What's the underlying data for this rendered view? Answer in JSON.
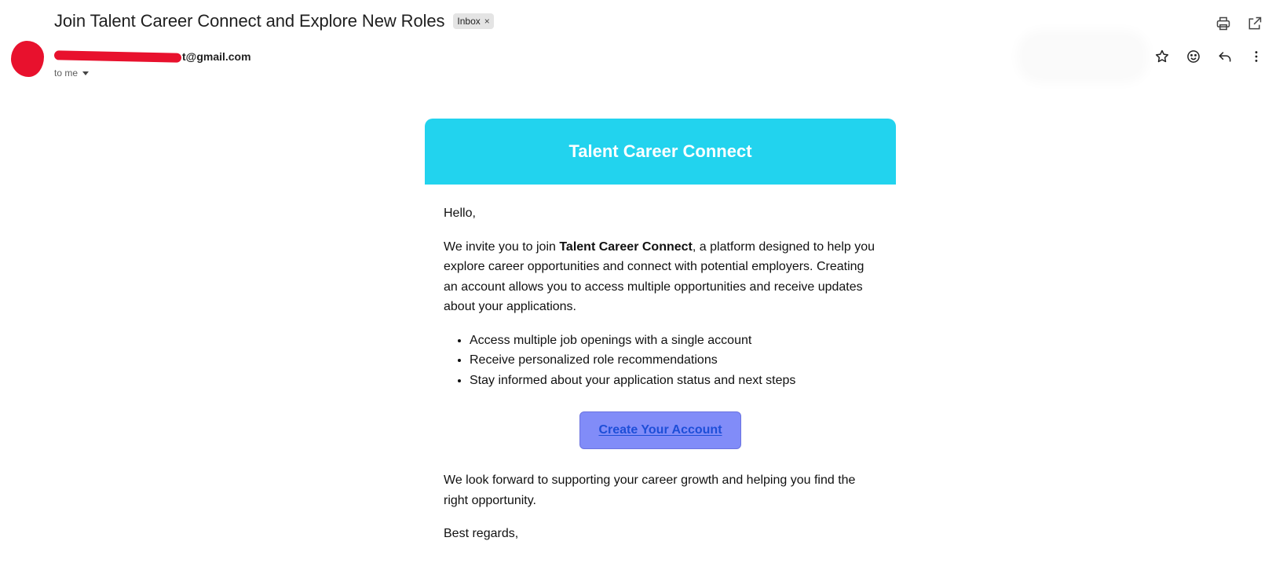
{
  "subject": "Join Talent Career Connect and Explore New Roles",
  "label": {
    "text": "Inbox",
    "remove": "×"
  },
  "sender": {
    "email_visible": "t@gmail.com",
    "recipient": "to me"
  },
  "toolbar_icons": [
    "print-icon",
    "open-in-new-window-icon"
  ],
  "message_icons": [
    "star-icon",
    "emoji-icon",
    "reply-icon",
    "more-vert-icon"
  ],
  "email": {
    "header_title": "Talent Career Connect",
    "greeting": "Hello,",
    "intro_prefix": "We invite you to join ",
    "intro_brand": "Talent Career Connect",
    "intro_suffix": ", a platform designed to help you explore career opportunities and connect with potential employers. Creating an account allows you to access multiple opportunities and receive updates about your applications.",
    "bullets": [
      "Access multiple job openings with a single account",
      "Receive personalized role recommendations",
      "Stay informed about your application status and next steps"
    ],
    "cta_label": "Create Your Account",
    "closing": "We look forward to supporting your career growth and helping you find the right opportunity.",
    "signoff": "Best regards,"
  },
  "colors": {
    "header_bg": "#22d3ee",
    "cta_bg": "#818cf8",
    "cta_text": "#1d4ed8",
    "avatar": "#e8112d"
  }
}
